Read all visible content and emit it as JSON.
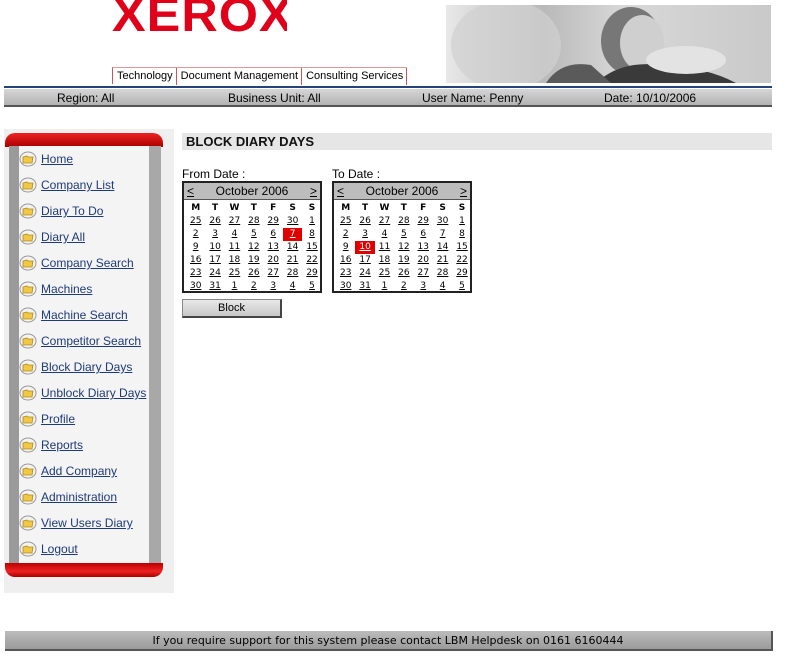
{
  "brand": {
    "logo_text": "XEROX",
    "accent": "#e0001a"
  },
  "header": {
    "tabs": [
      "Technology",
      "Document Management",
      "Consulting Services"
    ]
  },
  "infobar": {
    "region": "Region: All",
    "business_unit": "Business Unit: All",
    "user": "User Name: Penny",
    "date": "Date: 10/10/2006"
  },
  "sidebar": {
    "items": [
      {
        "label": "Home",
        "icon": "folder-icon"
      },
      {
        "label": "Company List",
        "icon": "folder-icon"
      },
      {
        "label": "Diary To Do",
        "icon": "folder-icon"
      },
      {
        "label": "Diary All",
        "icon": "folder-icon"
      },
      {
        "label": "Company Search",
        "icon": "folder-icon"
      },
      {
        "label": "Machines",
        "icon": "folder-icon"
      },
      {
        "label": "Machine Search",
        "icon": "folder-icon"
      },
      {
        "label": "Competitor Search",
        "icon": "folder-icon"
      },
      {
        "label": "Block Diary Days",
        "icon": "folder-icon"
      },
      {
        "label": "Unblock Diary Days",
        "icon": "folder-icon"
      },
      {
        "label": "Profile",
        "icon": "folder-icon"
      },
      {
        "label": "Reports",
        "icon": "folder-icon"
      },
      {
        "label": "Add Company",
        "icon": "folder-icon"
      },
      {
        "label": "Administration",
        "icon": "folder-icon"
      },
      {
        "label": "View Users Diary",
        "icon": "folder-icon"
      },
      {
        "label": "Logout",
        "icon": "folder-icon"
      }
    ]
  },
  "main": {
    "title": "BLOCK DIARY DAYS",
    "from_label": "From Date :",
    "to_label": "To Date :",
    "block_label": "Block",
    "calendars": [
      {
        "prev": "<",
        "next": ">",
        "month": "October 2006",
        "weekdays": [
          "M",
          "T",
          "W",
          "T",
          "F",
          "S",
          "S"
        ],
        "days": [
          "25",
          "26",
          "27",
          "28",
          "29",
          "30",
          "1",
          "2",
          "3",
          "4",
          "5",
          "6",
          "7",
          "8",
          "9",
          "10",
          "11",
          "12",
          "13",
          "14",
          "15",
          "16",
          "17",
          "18",
          "19",
          "20",
          "21",
          "22",
          "23",
          "24",
          "25",
          "26",
          "27",
          "28",
          "29",
          "30",
          "31",
          "1",
          "2",
          "3",
          "4",
          "5"
        ],
        "selected_index": 12
      },
      {
        "prev": "<",
        "next": ">",
        "month": "October 2006",
        "weekdays": [
          "M",
          "T",
          "W",
          "T",
          "F",
          "S",
          "S"
        ],
        "days": [
          "25",
          "26",
          "27",
          "28",
          "29",
          "30",
          "1",
          "2",
          "3",
          "4",
          "5",
          "6",
          "7",
          "8",
          "9",
          "10",
          "11",
          "12",
          "13",
          "14",
          "15",
          "16",
          "17",
          "18",
          "19",
          "20",
          "21",
          "22",
          "23",
          "24",
          "25",
          "26",
          "27",
          "28",
          "29",
          "30",
          "31",
          "1",
          "2",
          "3",
          "4",
          "5"
        ],
        "selected_index": 15
      }
    ]
  },
  "footer": {
    "text": "If you require support for this system please contact LBM Helpdesk on 0161 6160444"
  }
}
